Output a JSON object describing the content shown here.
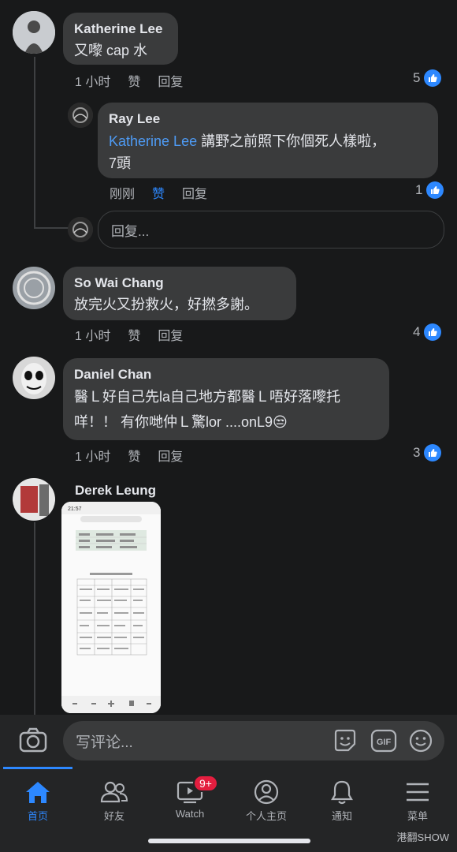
{
  "comments": [
    {
      "author": "Katherine Lee",
      "text": "又嚟 cap 水",
      "time": "1 小时",
      "like": "赞",
      "reply": "回复",
      "count": "5"
    },
    {
      "author": "Ray Lee",
      "mention": "Katherine Lee",
      "text": " 講野之前照下你個死人樣啦，",
      "text2": "7頭",
      "time": "刚刚",
      "like": "赞",
      "reply": "回复",
      "count": "1"
    },
    {
      "author": "So Wai Chang",
      "text": "放完火又扮救火，好撚多謝。",
      "time": "1 小时",
      "like": "赞",
      "reply": "回复",
      "count": "4"
    },
    {
      "author": "Daniel Chan",
      "text": "醫Ｌ好自己先la自己地方都醫Ｌ唔好落嚟托",
      "text2": "咩！！ 有你哋仲Ｌ驚lor ....onL9😒",
      "time": "1 小时",
      "like": "赞",
      "reply": "回复",
      "count": "3"
    },
    {
      "author": "Derek Leung"
    }
  ],
  "reply_placeholder": "回复...",
  "composer_placeholder": "写评论...",
  "screenshot_time": "21:57",
  "tabs": [
    {
      "label": "首页",
      "icon": "home-icon"
    },
    {
      "label": "好友",
      "icon": "friends-icon"
    },
    {
      "label": "Watch",
      "icon": "watch-icon",
      "badge": "9+"
    },
    {
      "label": "个人主页",
      "icon": "profile-icon"
    },
    {
      "label": "通知",
      "icon": "bell-icon"
    },
    {
      "label": "菜单",
      "icon": "menu-icon"
    }
  ],
  "watermark": "港翻SHOW",
  "colors": {
    "background": "#18191a",
    "bubble": "#3a3b3c",
    "accent": "#2d88ff",
    "badge": "#e41e3f"
  }
}
